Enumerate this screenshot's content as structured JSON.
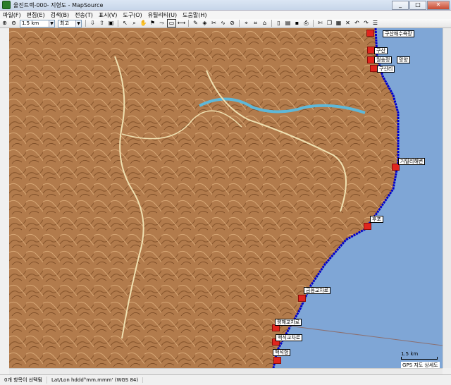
{
  "window": {
    "title": "울진트랙-000- 지형도 - MapSource"
  },
  "menu": [
    "파일(F)",
    "편집(E)",
    "검색(B)",
    "전송(T)",
    "표시(V)",
    "도구(O)",
    "유틸리티(U)",
    "도움말(H)"
  ],
  "toolbar": {
    "zoom_value": "1.5 km",
    "detail_value": "최고"
  },
  "waypoints": [
    "구산해수욕장",
    "구산",
    "월송정",
    "망양",
    "구산리",
    "거일리해변",
    "후포",
    "금음교차로",
    "평해교차로",
    "백석교차로",
    "백석항"
  ],
  "scale": {
    "label": "1.5 km"
  },
  "map_footer": "GPS 지도 상세도",
  "status": {
    "selection": "0개 항목이 선택됨",
    "position_format": "Lat/Lon hddd°mm.mmm' (WGS 84)"
  },
  "colors": {
    "terrain": "#b07a4a",
    "sea": "#7fa6d6",
    "track": "#0000cc"
  }
}
